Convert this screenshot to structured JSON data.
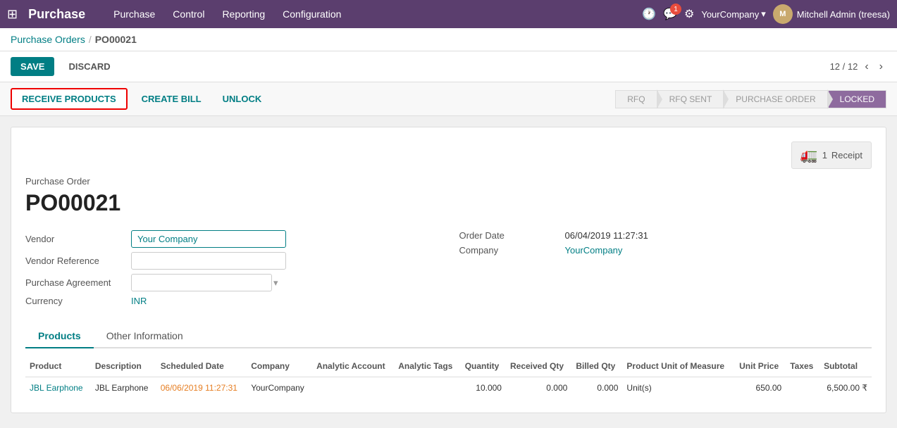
{
  "app": {
    "name": "Purchase"
  },
  "topnav": {
    "items": [
      {
        "label": "Purchase",
        "id": "purchase"
      },
      {
        "label": "Control",
        "id": "control"
      },
      {
        "label": "Reporting",
        "id": "reporting"
      },
      {
        "label": "Configuration",
        "id": "configuration"
      }
    ]
  },
  "topbar_right": {
    "notification_count": "1",
    "company": "YourCompany",
    "user": "Mitchell Admin (treesa)"
  },
  "breadcrumb": {
    "parent": "Purchase Orders",
    "separator": "/",
    "current": "PO00021"
  },
  "action_bar": {
    "save_label": "SAVE",
    "discard_label": "DISCARD",
    "pagination": "12 / 12"
  },
  "workflow_bar": {
    "receive_label": "RECEIVE PRODUCTS",
    "create_bill_label": "CREATE BILL",
    "unlock_label": "UNLOCK",
    "steps": [
      {
        "label": "RFQ",
        "active": false
      },
      {
        "label": "RFQ SENT",
        "active": false
      },
      {
        "label": "PURCHASE ORDER",
        "active": false
      },
      {
        "label": "LOCKED",
        "active": true
      }
    ]
  },
  "receipt_badge": {
    "count": "1",
    "label": "Receipt"
  },
  "purchase_order": {
    "label": "Purchase Order",
    "number": "PO00021"
  },
  "form": {
    "vendor_label": "Vendor",
    "vendor_value": "Your Company",
    "vendor_ref_label": "Vendor Reference",
    "vendor_ref_value": "",
    "purchase_agreement_label": "Purchase Agreement",
    "purchase_agreement_value": "",
    "currency_label": "Currency",
    "currency_value": "INR",
    "order_date_label": "Order Date",
    "order_date_value": "06/04/2019 11:27:31",
    "company_label": "Company",
    "company_value": "YourCompany"
  },
  "tabs": [
    {
      "label": "Products",
      "active": true
    },
    {
      "label": "Other Information",
      "active": false
    }
  ],
  "table": {
    "headers": [
      "Product",
      "Description",
      "Scheduled Date",
      "Company",
      "Analytic Account",
      "Analytic Tags",
      "Quantity",
      "Received Qty",
      "Billed Qty",
      "Product Unit of Measure",
      "Unit Price",
      "Taxes",
      "Subtotal"
    ],
    "rows": [
      {
        "product": "JBL Earphone",
        "description": "JBL Earphone",
        "scheduled_date": "06/06/2019 11:27:31",
        "company": "YourCompany",
        "analytic_account": "",
        "analytic_tags": "",
        "quantity": "10.000",
        "received_qty": "0.000",
        "billed_qty": "0.000",
        "unit_of_measure": "Unit(s)",
        "unit_price": "650.00",
        "taxes": "",
        "subtotal": "6,500.00 ₹"
      }
    ]
  }
}
